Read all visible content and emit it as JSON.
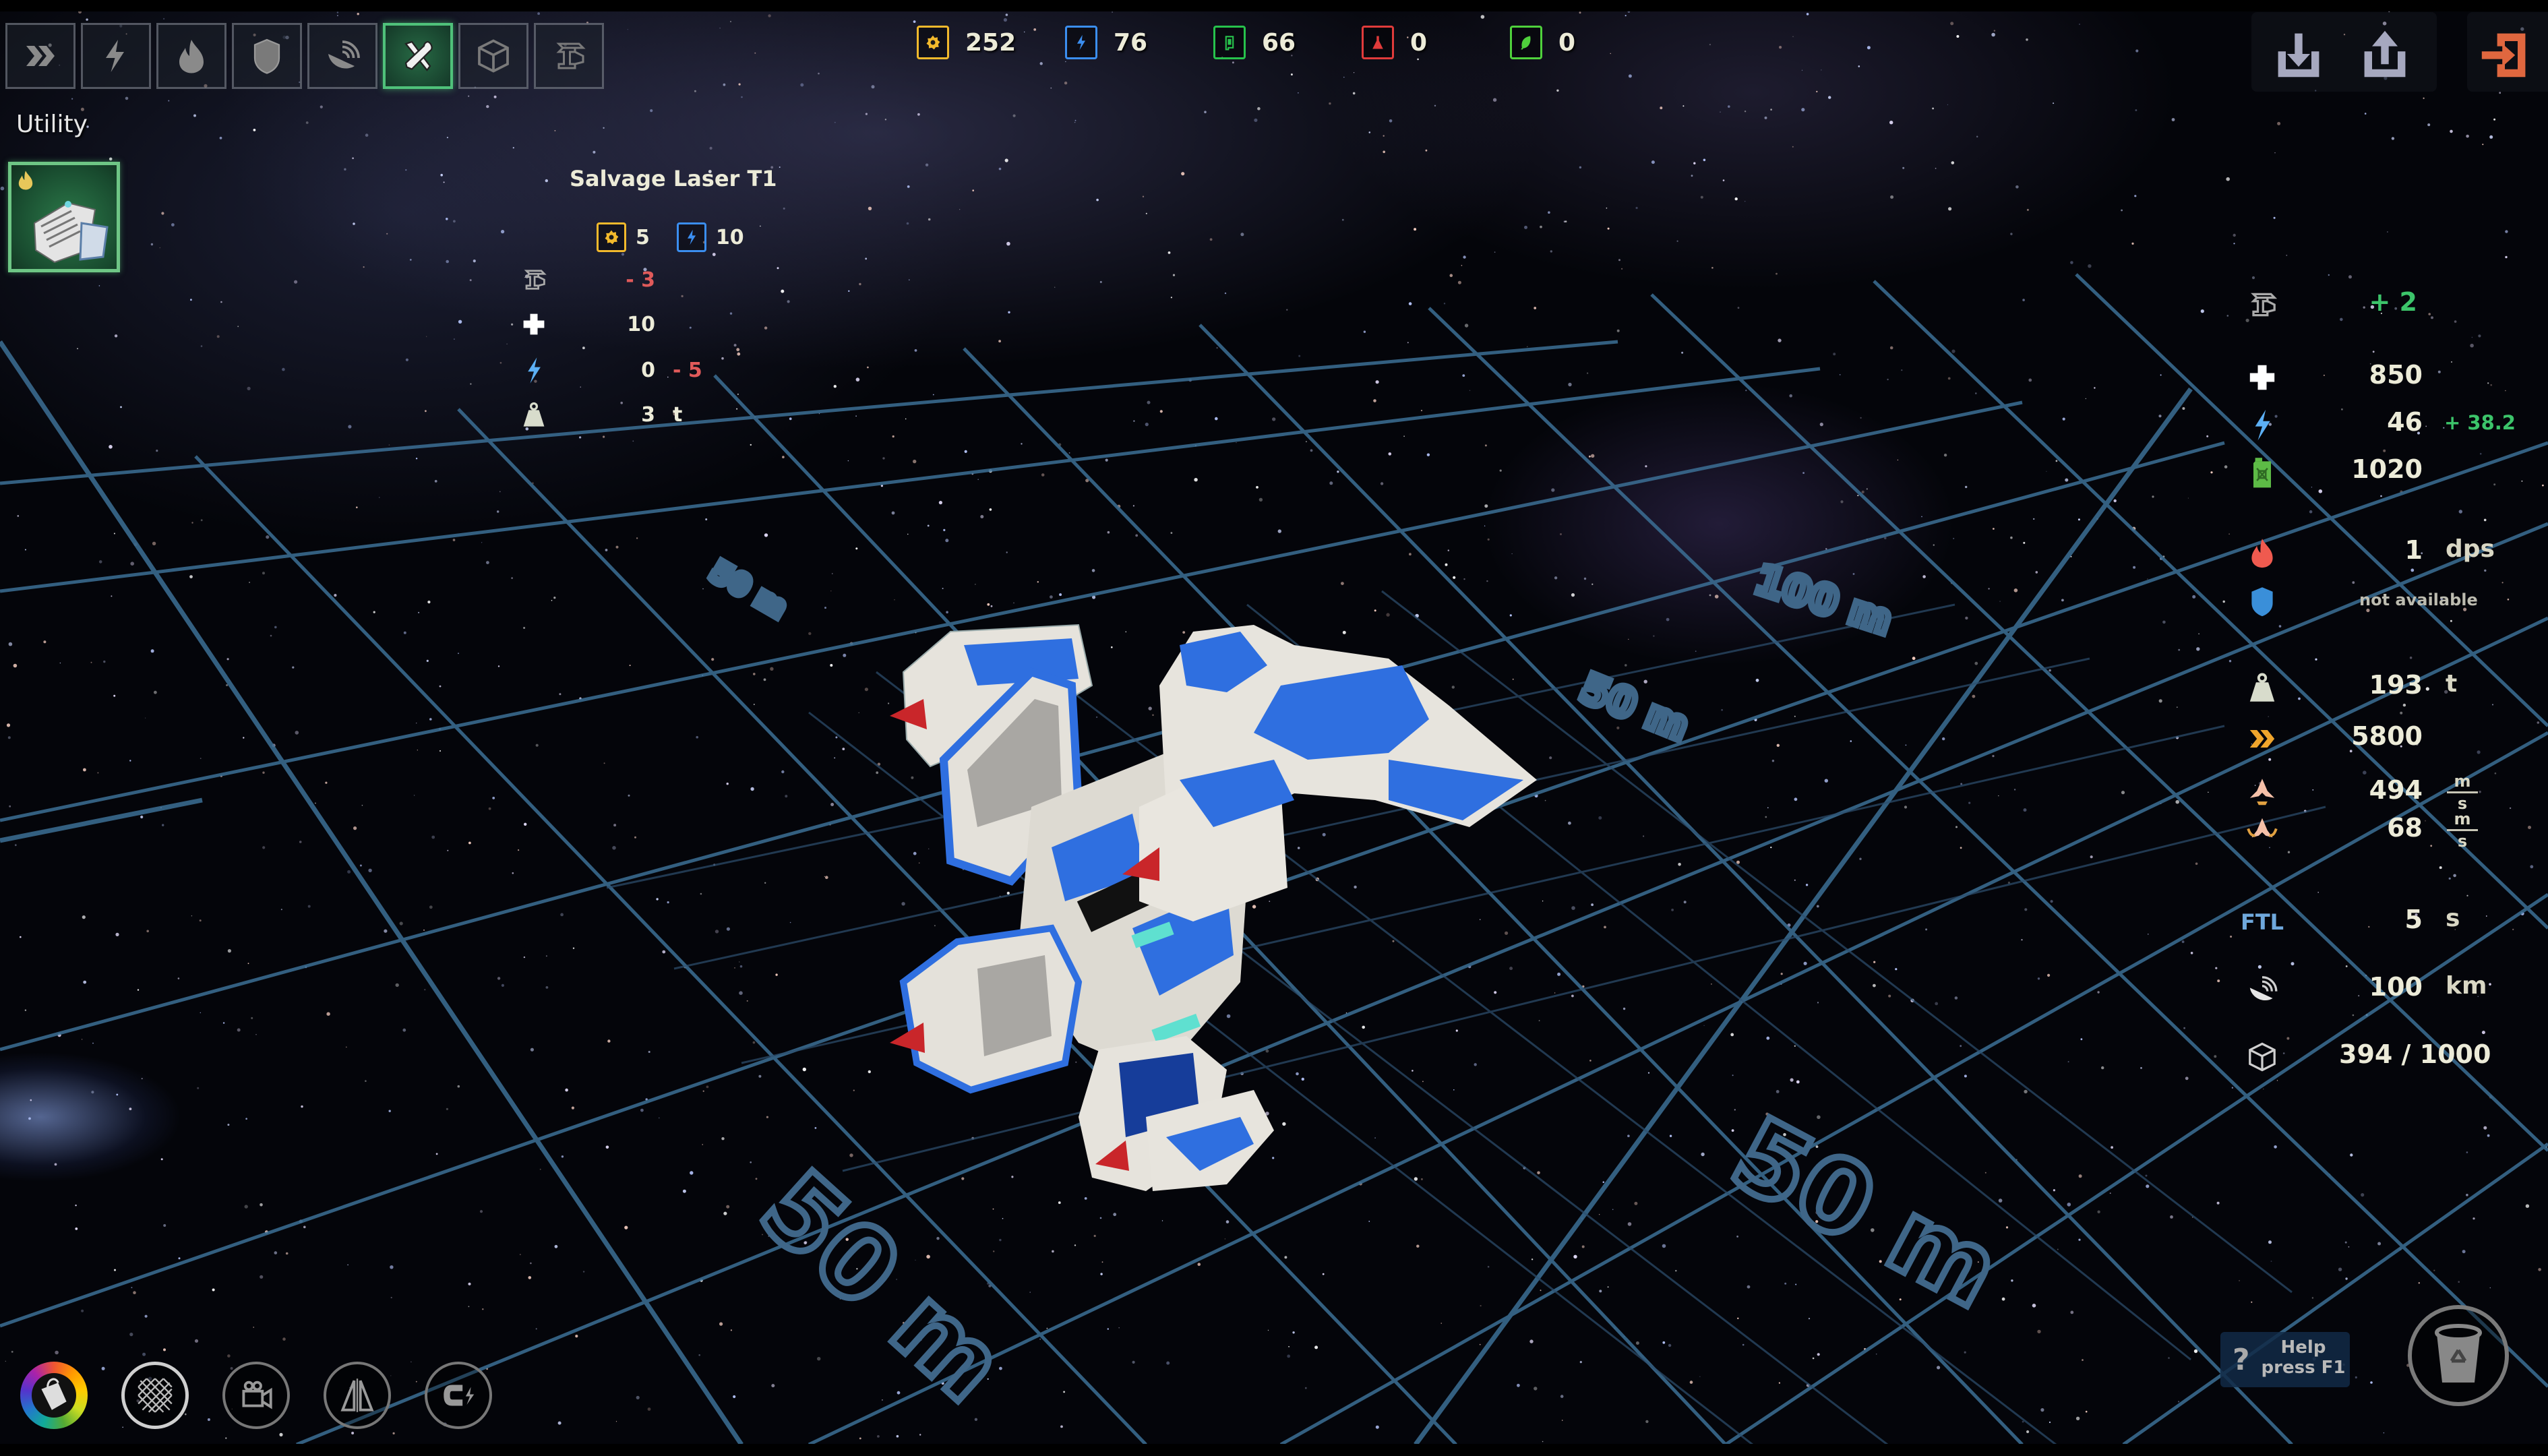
{
  "category_tabs": [
    {
      "id": "engines",
      "icon": "chevron-double-right-icon",
      "active": false
    },
    {
      "id": "power",
      "icon": "lightning-icon",
      "active": false
    },
    {
      "id": "weapons",
      "icon": "fire-icon",
      "active": false
    },
    {
      "id": "shields",
      "icon": "shield-icon",
      "active": false
    },
    {
      "id": "sensors",
      "icon": "radar-dish-icon",
      "active": false
    },
    {
      "id": "utility",
      "icon": "tools-icon",
      "active": true
    },
    {
      "id": "cargo",
      "icon": "cube-icon",
      "active": false
    },
    {
      "id": "structure",
      "icon": "girder-icon",
      "active": false
    }
  ],
  "section": {
    "title": "Utility"
  },
  "selected_module": {
    "name": "Salvage Laser T1",
    "badge_icon": "fire-icon"
  },
  "tooltip": {
    "title": "Salvage Laser T1",
    "cost": [
      {
        "resource": "credits",
        "icon": "gear-icon",
        "value": "5",
        "color": "#f2b92c"
      },
      {
        "resource": "energy",
        "icon": "lightning-icon",
        "value": "10",
        "color": "#3b8ef0"
      }
    ],
    "stats": [
      {
        "name": "structure",
        "icon": "girder-icon",
        "value": "- 3",
        "value_class": "neg",
        "extra": "",
        "extra_class": ""
      },
      {
        "name": "hull",
        "icon": "plus-icon",
        "value": "10",
        "value_class": "",
        "extra": "",
        "extra_class": ""
      },
      {
        "name": "power",
        "icon": "lightning-icon",
        "value": "0",
        "value_class": "",
        "extra": "- 5",
        "extra_class": "neg"
      },
      {
        "name": "mass",
        "icon": "weight-icon",
        "value": "3",
        "value_class": "",
        "extra": "t",
        "extra_class": ""
      }
    ]
  },
  "resources": [
    {
      "name": "credits",
      "icon": "gear-icon",
      "value": "252",
      "color": "#f2b92c"
    },
    {
      "name": "energy",
      "icon": "lightning-icon",
      "value": "76",
      "color": "#3b8ef0"
    },
    {
      "name": "fuel",
      "icon": "fuel-canister-icon",
      "value": "66",
      "color": "#27c24c"
    },
    {
      "name": "science",
      "icon": "flask-icon",
      "value": "0",
      "color": "#e03b3b"
    },
    {
      "name": "bio",
      "icon": "leaf-icon",
      "value": "0",
      "color": "#4fd13c"
    }
  ],
  "top_right": {
    "import_icon": "import-icon",
    "export_icon": "export-icon",
    "exit_icon": "exit-icon",
    "exit_color": "#e0673f"
  },
  "ship_stats": {
    "structure": {
      "icon": "girder-icon",
      "value": "+ 2"
    },
    "hull": {
      "icon": "plus-icon",
      "value": "850"
    },
    "power": {
      "icon": "lightning-icon",
      "value": "46",
      "delta": "+ 38.2"
    },
    "fuel": {
      "icon": "fuel-canister-icon",
      "value": "1020"
    },
    "damage": {
      "icon": "fire-icon",
      "value": "1",
      "unit": "dps"
    },
    "shield": {
      "icon": "shield-icon",
      "value": "not available"
    },
    "mass": {
      "icon": "weight-icon",
      "value": "193",
      "unit": "t"
    },
    "thrust": {
      "icon": "chevron-double-right-icon",
      "value": "5800"
    },
    "speed": {
      "icon": "ship-speed-icon",
      "value": "494",
      "unit_top": "m",
      "unit_bottom": "s"
    },
    "turn": {
      "icon": "ship-turn-icon",
      "value": "68",
      "unit_top": "m",
      "unit_bottom": "s"
    },
    "ftl": {
      "label": "FTL",
      "value": "5",
      "unit": "s"
    },
    "sensor": {
      "icon": "radar-dish-icon",
      "value": "100",
      "unit": "km"
    },
    "cargo": {
      "icon": "cube-icon",
      "value": "394 / 1000"
    }
  },
  "grid_labels": [
    "50 m",
    "50 m",
    "50 m",
    "100 m",
    "50 m"
  ],
  "bottom_tools": [
    {
      "name": "paint",
      "icon": "paint-bucket-icon"
    },
    {
      "name": "grid-toggle",
      "icon": "grid-icon"
    },
    {
      "name": "camera",
      "icon": "camera-icon"
    },
    {
      "name": "mirror",
      "icon": "mirror-icon"
    },
    {
      "name": "magnet",
      "icon": "magnet-icon"
    }
  ],
  "help": {
    "icon": "?",
    "line1": "Help",
    "line2": "press F1"
  },
  "trash": {
    "icon": "recycle-bin-icon"
  }
}
